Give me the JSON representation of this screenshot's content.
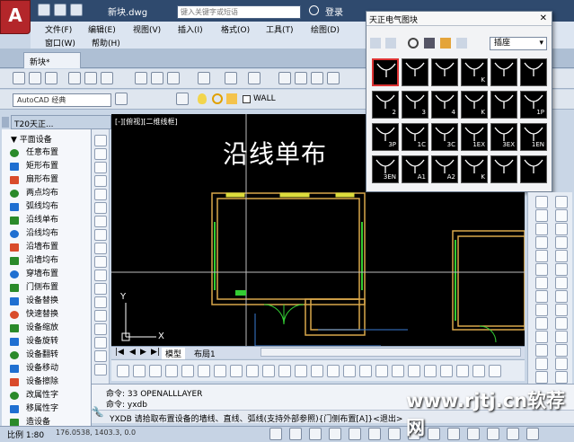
{
  "titlebar": {
    "doc_title": "新块.dwg",
    "search_placeholder": "键入关键字或短语",
    "login": "登录"
  },
  "menu": [
    "文件(F)",
    "编辑(E)",
    "视图(V)",
    "插入(I)",
    "格式(O)",
    "工具(T)",
    "绘图(D)",
    "窗口(W)",
    "帮助(H)"
  ],
  "doc_tab": "新块*",
  "workspace": "AutoCAD 经典",
  "layer_name": "WALL",
  "left_panel": {
    "header": "T20天正...",
    "section": "平面设备",
    "items": [
      "任意布置",
      "矩形布置",
      "扇形布置",
      "两点均布",
      "弧线均布",
      "沿线单布",
      "沿线均布",
      "沿墙布置",
      "沿墙均布",
      "穿墙布置",
      "门侧布置",
      "设备替换",
      "快速替换",
      "设备缩放",
      "设备旋转",
      "设备翻转",
      "设备移动",
      "设备擦除",
      "改属性字",
      "移属性字",
      "造设备"
    ]
  },
  "viewport_label": "[-][俯视][二维线框]",
  "canvas_title": "沿线单布",
  "palette": {
    "title": "天正电气图块",
    "category": "插座",
    "cells": [
      "",
      "",
      "",
      "K",
      "",
      "",
      "2",
      "3",
      "4",
      "K",
      "",
      "1P",
      "3P",
      "1C",
      "3C",
      "1EX",
      "3EX",
      "1EN",
      "3EN",
      "A1",
      "A2",
      "K",
      "",
      ""
    ]
  },
  "layout_tabs": [
    "模型",
    "布局1"
  ],
  "command": {
    "line1": "命令: 33 OPENALLLAYER",
    "line2": "命令: yxdb",
    "prompt": "YXDB 请拾取布置设备的墙线、直线、弧线(支持外部参照){门侧布置[A]}<退出>"
  },
  "status": {
    "scale": "比例 1:80",
    "coords": "176.0538, 1403.3, 0.0"
  },
  "watermark": "www.rjtj.cn软荐网",
  "colors": {
    "wall": "#d9a74a",
    "green_line": "#33cc33",
    "accent_red": "#d33",
    "titlebar": "#2f4a6e"
  }
}
